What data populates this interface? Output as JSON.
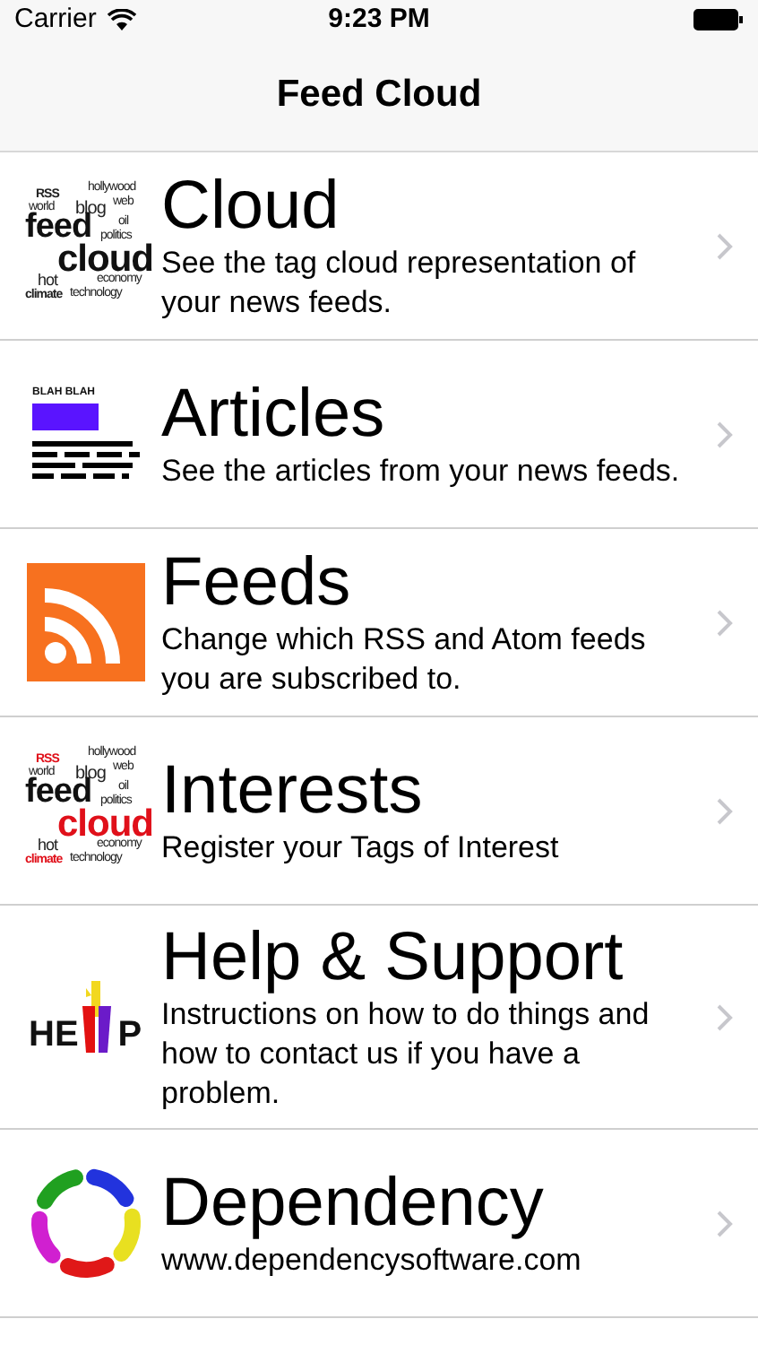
{
  "status_bar": {
    "carrier": "Carrier",
    "time": "9:23 PM"
  },
  "nav_bar": {
    "title": "Feed Cloud"
  },
  "menu": [
    {
      "kind": "cloud",
      "title": "Cloud",
      "description": "See the tag cloud representation of your news feeds.",
      "icon_words": [
        {
          "text": "RSS",
          "color": "#222222"
        },
        {
          "text": "hollywood",
          "color": "#222222"
        },
        {
          "text": "world",
          "color": "#222222"
        },
        {
          "text": "blog",
          "color": "#222222"
        },
        {
          "text": "web",
          "color": "#222222"
        },
        {
          "text": "feed",
          "color": "#111111"
        },
        {
          "text": "oil",
          "color": "#222222"
        },
        {
          "text": "politics",
          "color": "#222222"
        },
        {
          "text": "cloud",
          "color": "#111111"
        },
        {
          "text": "hot",
          "color": "#222222"
        },
        {
          "text": "economy",
          "color": "#222222"
        },
        {
          "text": "climate",
          "color": "#222222"
        },
        {
          "text": "technology",
          "color": "#222222"
        }
      ]
    },
    {
      "kind": "articles",
      "title": "Articles",
      "description": "See the articles from your news feeds.",
      "icon_words": [
        {
          "text": "BLAH BLAH",
          "color": "#111111"
        }
      ]
    },
    {
      "kind": "rss",
      "title": "Feeds",
      "description": "Change which RSS and Atom feeds you are subscribed to."
    },
    {
      "kind": "cloud",
      "title": "Interests",
      "description": "Register your Tags of Interest",
      "icon_words": [
        {
          "text": "RSS",
          "color": "#e0101a"
        },
        {
          "text": "hollywood",
          "color": "#222222"
        },
        {
          "text": "world",
          "color": "#222222"
        },
        {
          "text": "blog",
          "color": "#222222"
        },
        {
          "text": "web",
          "color": "#222222"
        },
        {
          "text": "feed",
          "color": "#111111"
        },
        {
          "text": "oil",
          "color": "#222222"
        },
        {
          "text": "politics",
          "color": "#222222"
        },
        {
          "text": "cloud",
          "color": "#e0101a"
        },
        {
          "text": "hot",
          "color": "#222222"
        },
        {
          "text": "economy",
          "color": "#222222"
        },
        {
          "text": "climate",
          "color": "#e0101a"
        },
        {
          "text": "technology",
          "color": "#222222"
        }
      ]
    },
    {
      "kind": "help",
      "title": "Help & Support",
      "description": "Instructions on how to do things and how to contact us if you have a problem.",
      "icon_words": [
        {
          "text": "HE",
          "color": "#111111"
        },
        {
          "text": "P",
          "color": "#111111"
        }
      ]
    },
    {
      "kind": "ring",
      "title": "Dependency",
      "description": "www.dependencysoftware.com"
    }
  ]
}
